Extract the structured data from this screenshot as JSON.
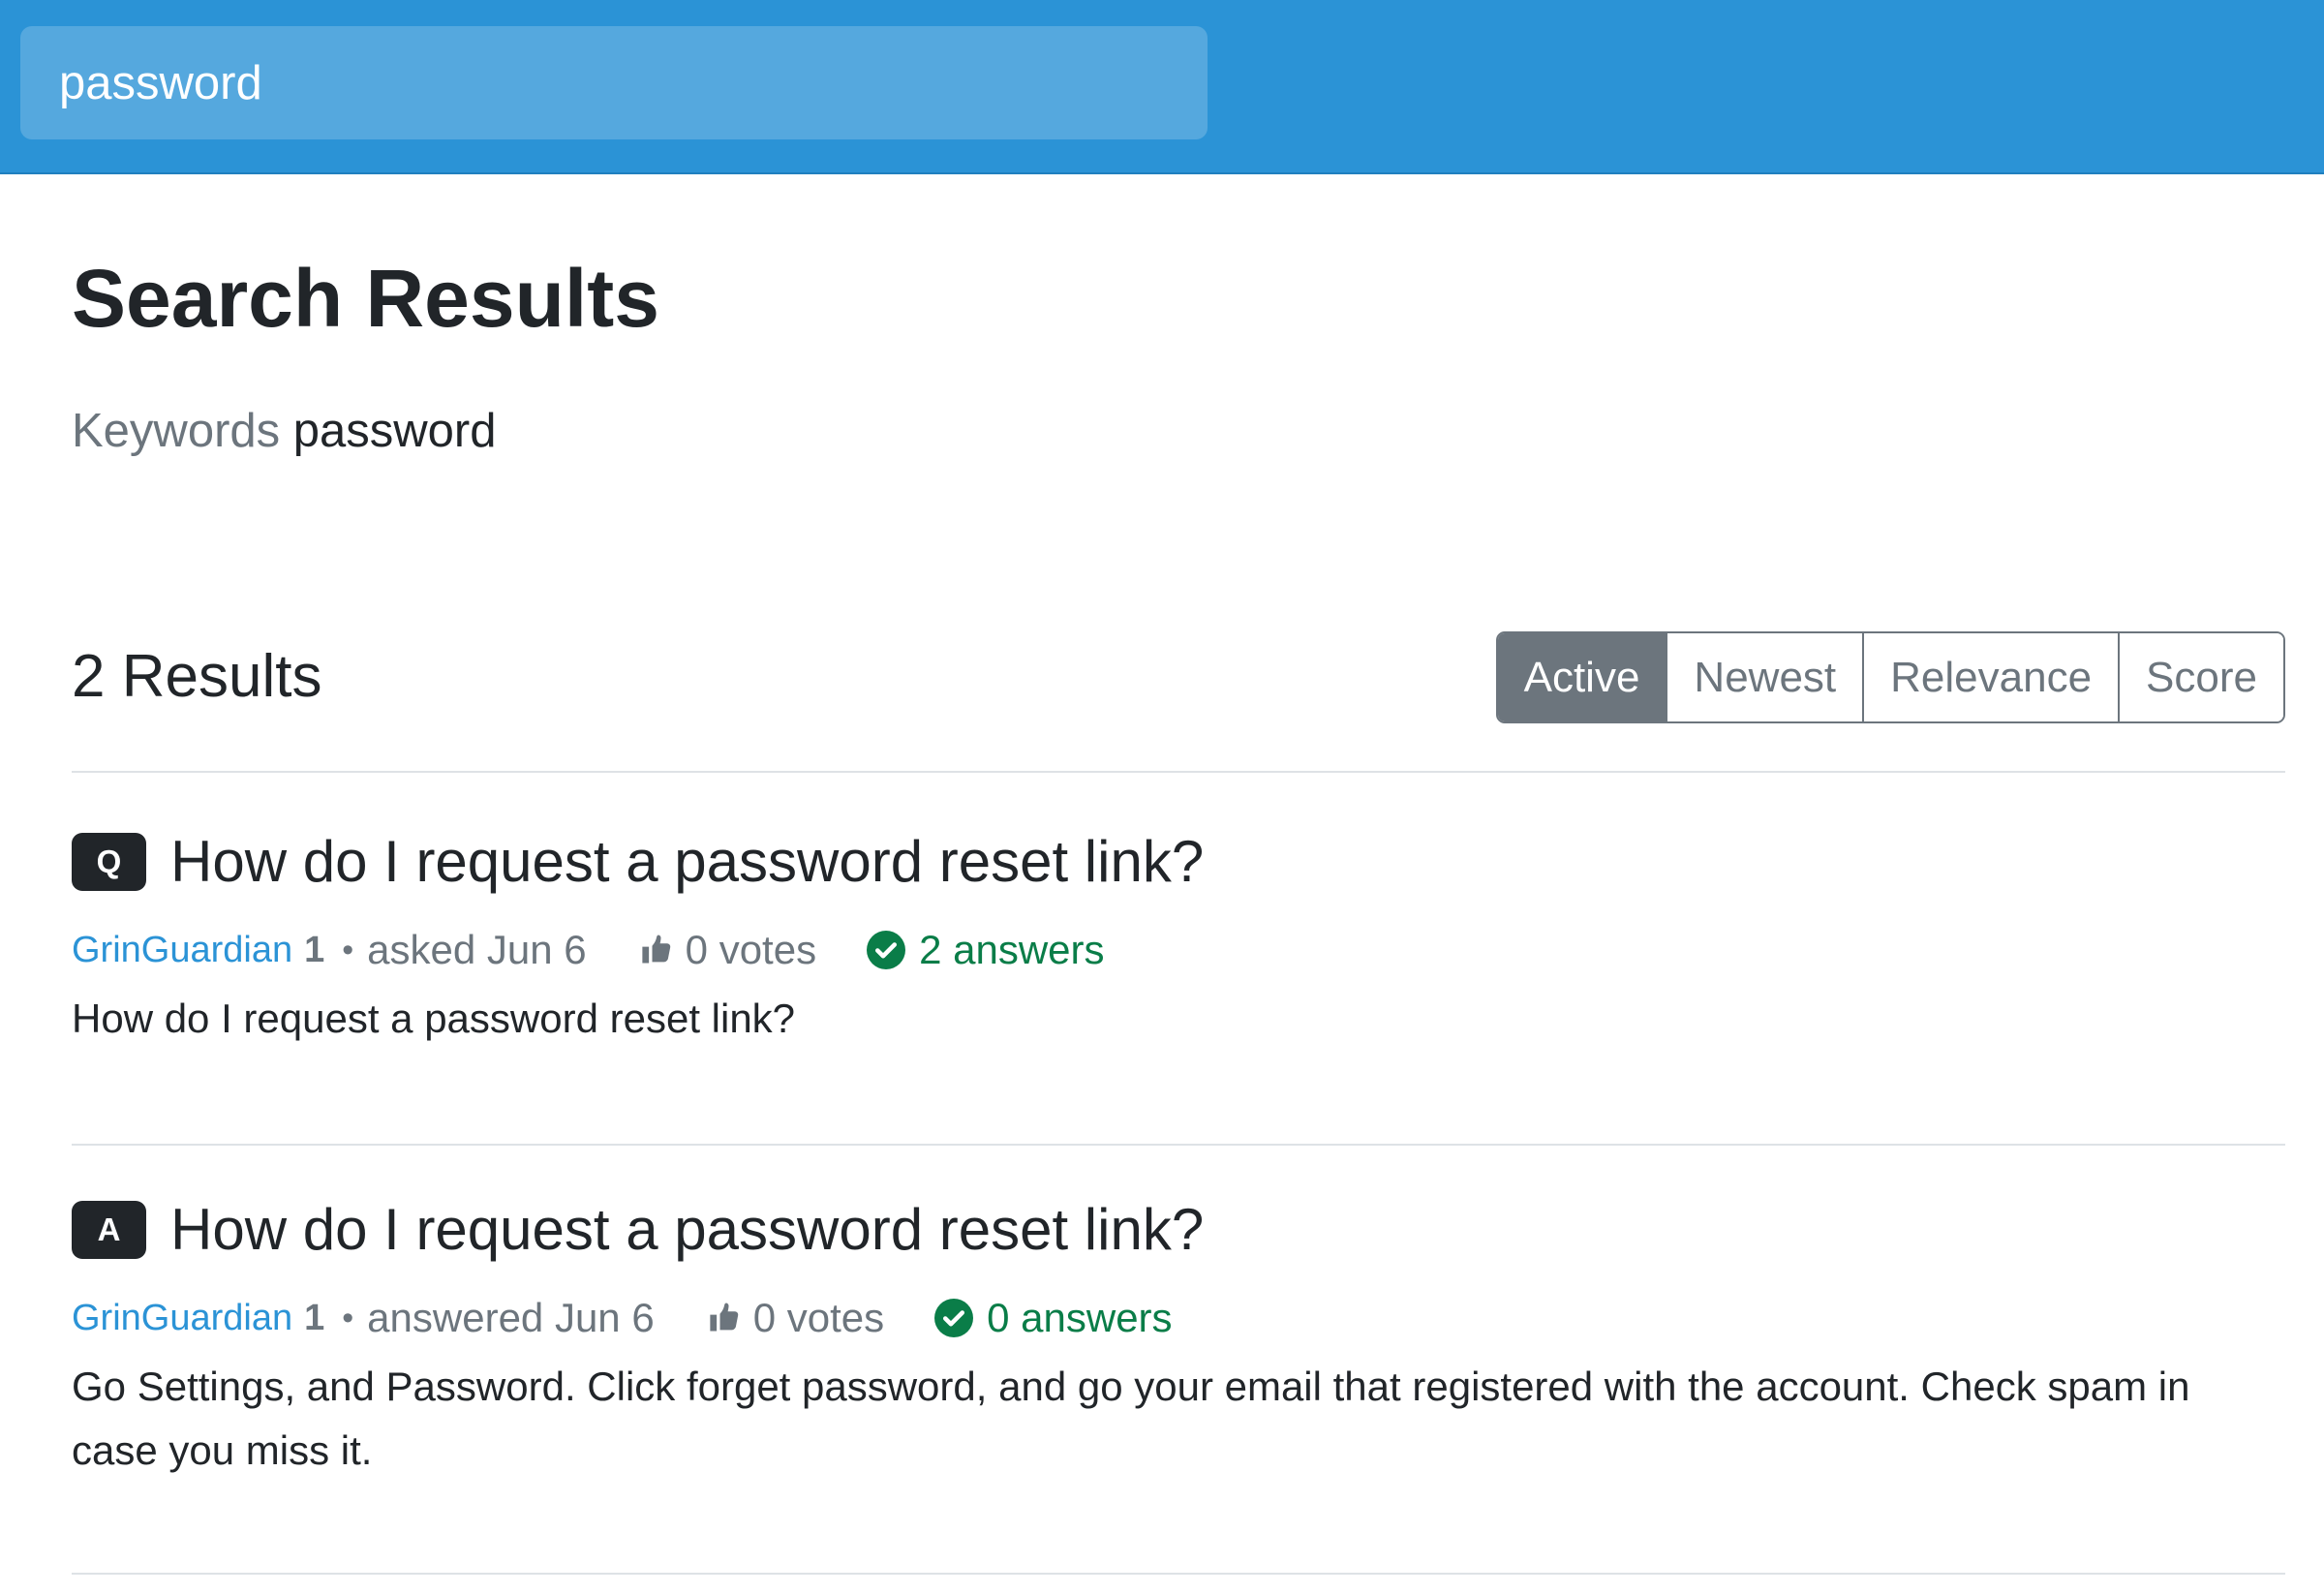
{
  "search": {
    "value": "password"
  },
  "page": {
    "title": "Search Results",
    "keywords_label": "Keywords",
    "keywords_value": "password"
  },
  "results_header": {
    "count_label": "2 Results"
  },
  "sort": {
    "options": [
      "Active",
      "Newest",
      "Relevance",
      "Score"
    ],
    "active": "Active"
  },
  "results": [
    {
      "badge": "Q",
      "title": "How do I request a password reset link?",
      "author": "GrinGuardian",
      "reputation": "1",
      "action": "asked Jun 6",
      "votes": "0 votes",
      "answers": "2 answers",
      "excerpt": "How do I request a password reset link?"
    },
    {
      "badge": "A",
      "title": "How do I request a password reset link?",
      "author": "GrinGuardian",
      "reputation": "1",
      "action": "answered Jun 6",
      "votes": "0 votes",
      "answers": "0 answers",
      "excerpt": "Go Settings, and Password. Click forget password, and go your email that registered with the account. Check spam in case you miss it."
    }
  ],
  "colors": {
    "header": "#2b93d6",
    "link": "#2b93d6",
    "accepted": "#0a7d48",
    "sort_active": "#6c757d"
  }
}
